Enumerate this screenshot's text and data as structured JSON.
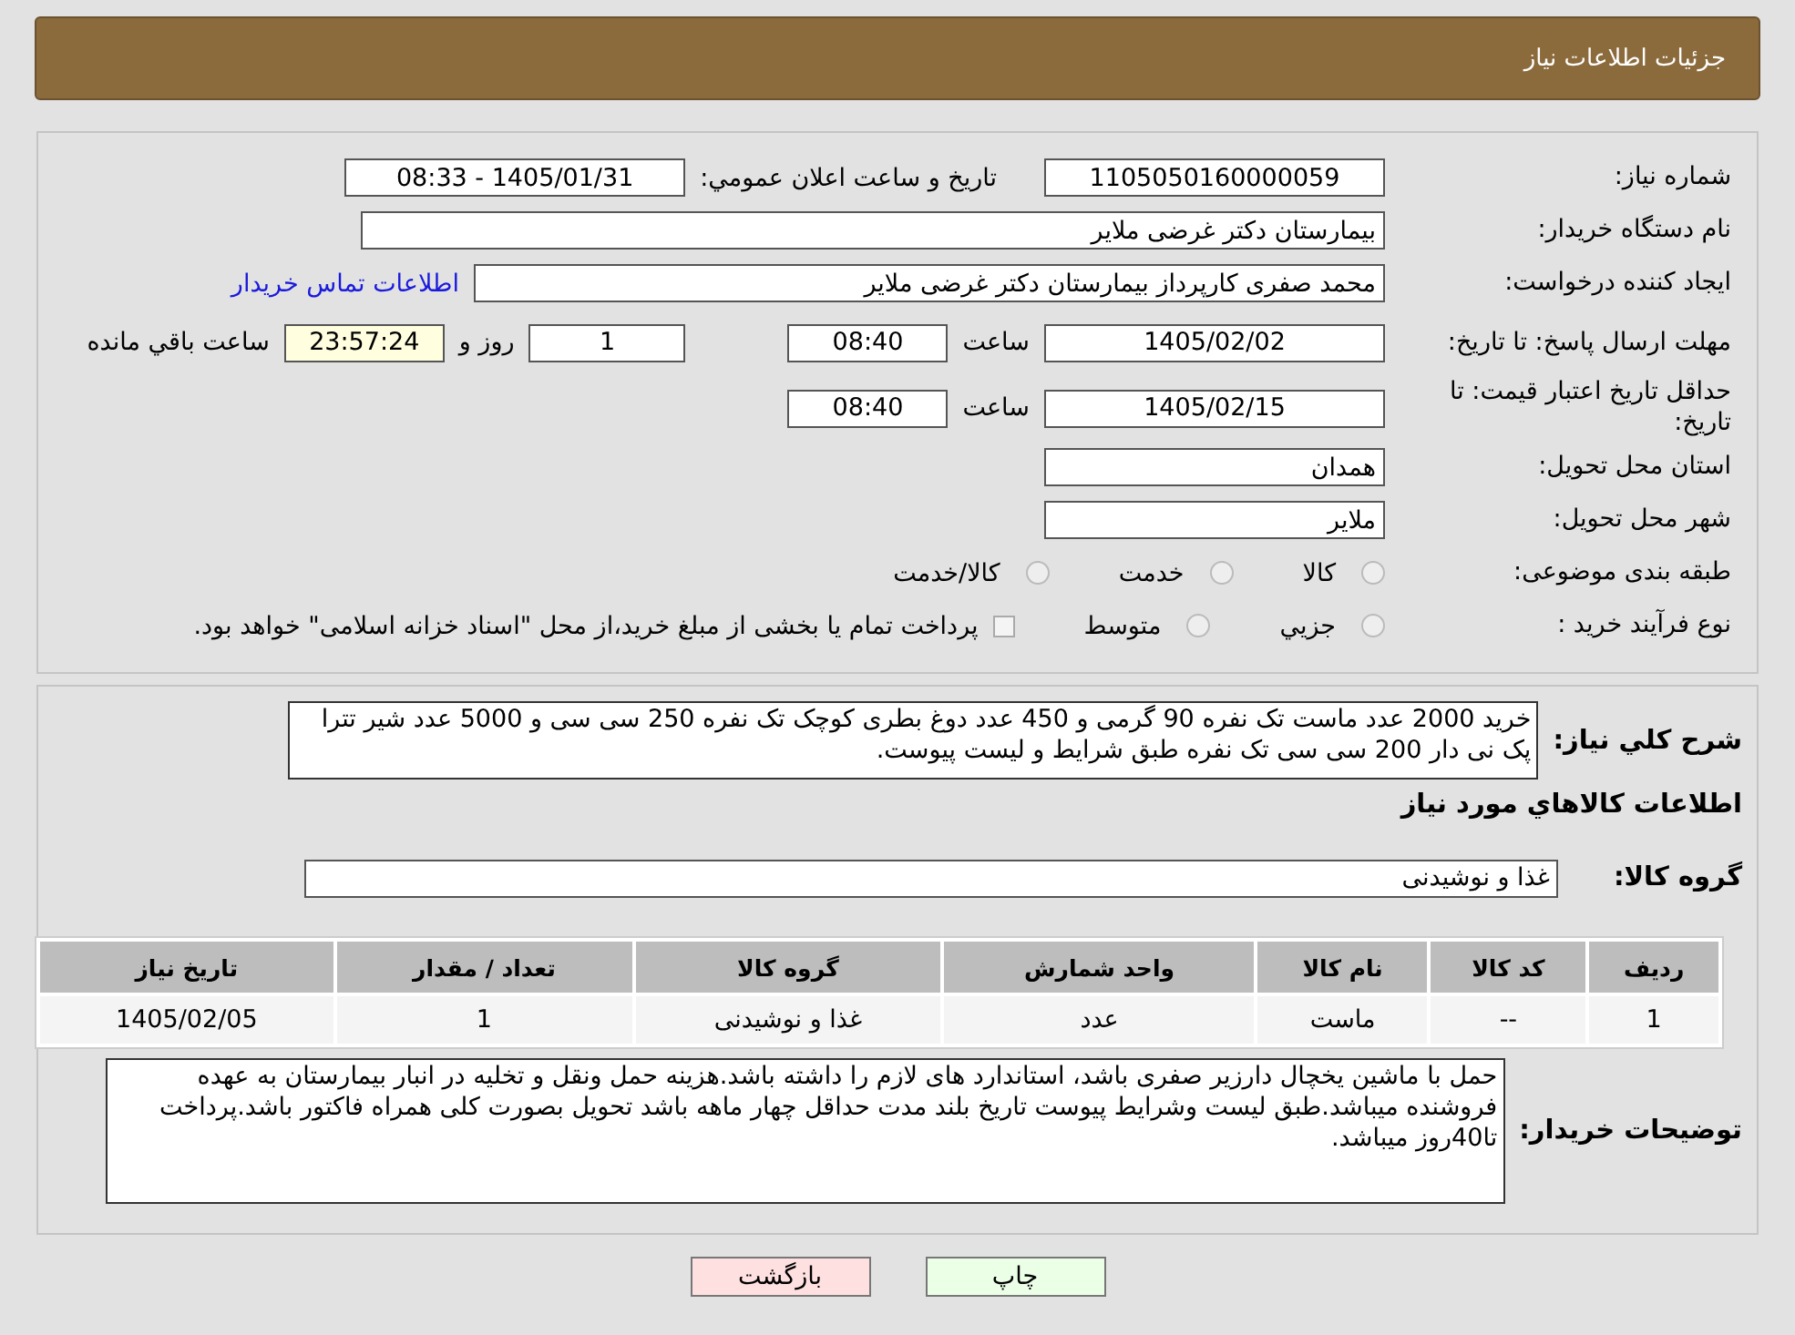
{
  "header": {
    "title": "جزئیات اطلاعات نیاز"
  },
  "need_number": {
    "label": "شماره نیاز:",
    "value": "1105050160000059"
  },
  "announce": {
    "label": "تاريخ و ساعت اعلان عمومي:",
    "value": "1405/01/31 - 08:33"
  },
  "buyer_org": {
    "label": "نام دستگاه خریدار:",
    "value": "بیمارستان دکتر غرضی ملایر"
  },
  "requester": {
    "label": "ایجاد کننده درخواست:",
    "value": "محمد صفری کارپرداز بیمارستان دکتر غرضی ملایر",
    "link": "اطلاعات تماس خریدار"
  },
  "deadline": {
    "label": "مهلت ارسال پاسخ: تا تاریخ:",
    "date": "1405/02/02",
    "time_label": "ساعت",
    "time": "08:40",
    "days": "1",
    "days_label": "روز و",
    "remaining": "23:57:24",
    "remaining_label": "ساعت باقي مانده"
  },
  "validity": {
    "label": "حداقل تاریخ اعتبار قیمت: تا تاریخ:",
    "date": "1405/02/15",
    "time_label": "ساعت",
    "time": "08:40"
  },
  "province": {
    "label": "استان محل تحویل:",
    "value": "همدان"
  },
  "city": {
    "label": "شهر محل تحویل:",
    "value": "ملایر"
  },
  "category": {
    "label": "طبقه بندی موضوعی:",
    "options": [
      {
        "label": "کالا",
        "selected": false
      },
      {
        "label": "خدمت",
        "selected": false
      },
      {
        "label": "کالا/خدمت",
        "selected": false
      }
    ]
  },
  "purchase_type": {
    "label": "نوع فرآیند خرید :",
    "options": [
      {
        "label": "جزیي",
        "selected": false
      },
      {
        "label": "متوسط",
        "selected": false
      }
    ],
    "note": {
      "text": "پرداخت تمام یا بخشی از مبلغ خرید،از محل \"اسناد خزانه اسلامی\" خواهد بود.",
      "checked": false
    }
  },
  "description": {
    "label": "شرح کلي نیاز:",
    "value": "خرید 2000 عدد ماست تک نفره 90 گرمی و 450  عدد دوغ بطری کوچک تک نفره 250 سی سی و 5000 عدد شیر تترا پک نی دار 200 سی سی تک نفره  طبق شرایط و لیست پیوست."
  },
  "items_heading": "اطلاعات کالاهاي مورد نیاز",
  "goods_group": {
    "label": "گروه کالا:",
    "value": "غذا و نوشیدنی"
  },
  "table": {
    "columns": [
      "ردیف",
      "کد کالا",
      "نام کالا",
      "واحد شمارش",
      "گروه کالا",
      "تعداد / مقدار",
      "تاریخ نیاز"
    ],
    "rows": [
      [
        "1",
        "--",
        "ماست",
        "عدد",
        "غذا و نوشیدنی",
        "1",
        "1405/02/05"
      ]
    ]
  },
  "buyer_notes": {
    "label": "توضیحات خریدار:",
    "value": "حمل با ماشین یخچال دارزیر صفری باشد، استاندارد های لازم را داشته باشد.هزینه حمل ونقل و تخلیه در انبار بیمارستان به عهده فروشنده میباشد.طبق لیست وشرایط پیوست تاریخ بلند مدت حداقل چهار ماهه باشد تحویل بصورت کلی همراه فاکتور باشد.پرداخت تا40روز میباشد."
  },
  "buttons": [
    {
      "kind": "print",
      "label": "چاپ"
    },
    {
      "kind": "back",
      "label": "بازگشت"
    }
  ]
}
